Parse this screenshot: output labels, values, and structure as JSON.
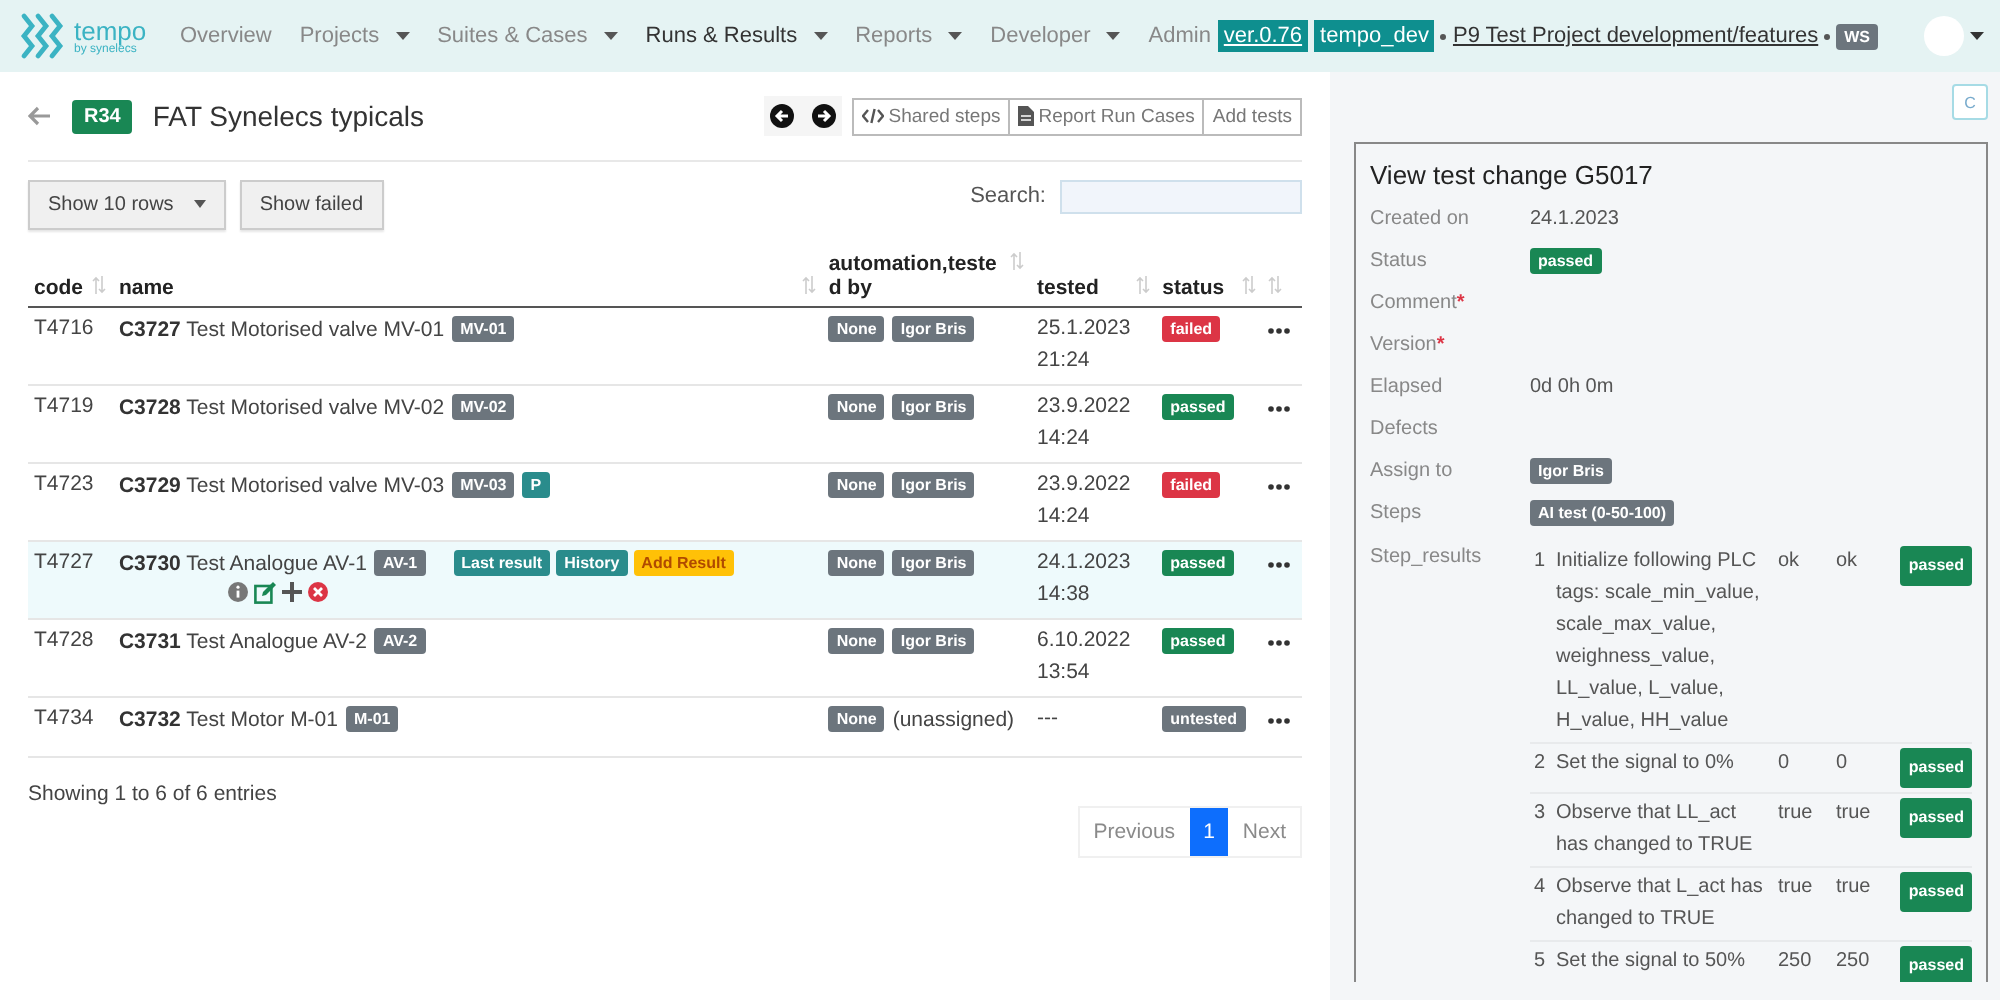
{
  "nav": {
    "logo": {
      "name": "tempo",
      "sub": "by synelecs"
    },
    "items": [
      {
        "label": "Overview",
        "dropdown": false,
        "selected": false
      },
      {
        "label": "Projects",
        "dropdown": true,
        "selected": false
      },
      {
        "label": "Suites & Cases",
        "dropdown": true,
        "selected": false
      },
      {
        "label": "Runs & Results",
        "dropdown": true,
        "selected": true
      },
      {
        "label": "Reports",
        "dropdown": true,
        "selected": false
      },
      {
        "label": "Developer",
        "dropdown": true,
        "selected": false
      },
      {
        "label": "Admin",
        "dropdown": false,
        "selected": false
      }
    ],
    "version": "ver.0.76",
    "env": "tempo_dev",
    "project": "P9 Test Project development/features",
    "user_badge": "WS"
  },
  "header": {
    "run_badge": "R34",
    "title": "FAT Synelecs typicals",
    "buttons": [
      {
        "label": "Shared steps",
        "kind": "code"
      },
      {
        "label": "Report Run Cases",
        "kind": "doc"
      },
      {
        "label": "Add tests",
        "kind": "plain"
      }
    ]
  },
  "controls": {
    "show_rows": "Show 10 rows",
    "show_failed": "Show failed",
    "search_label": "Search:"
  },
  "table": {
    "columns": [
      "code",
      "name",
      "automation,tested by",
      "tested",
      "status"
    ],
    "rows": [
      {
        "code": "T4716",
        "case": "C3727",
        "name": "Test Motorised valve MV-01",
        "tags": [
          {
            "label": "MV-01",
            "color": "#6c757d"
          }
        ],
        "selected": false,
        "automation": "None",
        "tester": "Igor Bris",
        "assigned": true,
        "tested": "25.1.2023 21:24",
        "status": {
          "label": "failed",
          "kind": "failed"
        }
      },
      {
        "code": "T4719",
        "case": "C3728",
        "name": "Test Motorised valve MV-02",
        "tags": [
          {
            "label": "MV-02",
            "color": "#6c757d"
          }
        ],
        "selected": false,
        "automation": "None",
        "tester": "Igor Bris",
        "assigned": true,
        "tested": "23.9.2022 14:24",
        "status": {
          "label": "passed",
          "kind": "passed"
        }
      },
      {
        "code": "T4723",
        "case": "C3729",
        "name": "Test Motorised valve MV-03",
        "tags": [
          {
            "label": "MV-03",
            "color": "#6c757d"
          },
          {
            "label": "P",
            "color": "#2a8c8c"
          }
        ],
        "selected": false,
        "automation": "None",
        "tester": "Igor Bris",
        "assigned": true,
        "tested": "23.9.2022 14:24",
        "status": {
          "label": "failed",
          "kind": "failed"
        }
      },
      {
        "code": "T4727",
        "case": "C3730",
        "name": "Test Analogue AV-1",
        "tags": [
          {
            "label": "AV-1",
            "color": "#6c757d"
          }
        ],
        "actions": [
          "Last result",
          "History",
          "Add Result"
        ],
        "selected": true,
        "automation": "None",
        "tester": "Igor Bris",
        "assigned": true,
        "tested": "24.1.2023 14:38",
        "status": {
          "label": "passed",
          "kind": "passed"
        }
      },
      {
        "code": "T4728",
        "case": "C3731",
        "name": "Test Analogue AV-2",
        "tags": [
          {
            "label": "AV-2",
            "color": "#6c757d"
          }
        ],
        "selected": false,
        "automation": "None",
        "tester": "Igor Bris",
        "assigned": true,
        "tested": "6.10.2022 13:54",
        "status": {
          "label": "passed",
          "kind": "passed"
        }
      },
      {
        "code": "T4734",
        "case": "C3732",
        "name": "Test Motor M-01",
        "tags": [
          {
            "label": "M-01",
            "color": "#6c757d"
          }
        ],
        "selected": false,
        "automation": "None",
        "tester": "(unassigned)",
        "assigned": false,
        "tested": "---",
        "status": {
          "label": "untested",
          "kind": "untested"
        }
      }
    ]
  },
  "footer": {
    "info": "Showing 1 to 6 of 6 entries",
    "pages": [
      {
        "label": "Previous",
        "selected": false,
        "disabled": true
      },
      {
        "label": "1",
        "selected": true,
        "disabled": false
      },
      {
        "label": "Next",
        "selected": false,
        "disabled": true
      }
    ]
  },
  "panel": {
    "corner_button": "C",
    "required_mark": "*",
    "title": "View test change G5017",
    "fields": [
      {
        "label": "Created on",
        "required": false,
        "kind": "text",
        "value": "24.1.2023"
      },
      {
        "label": "Status",
        "required": false,
        "kind": "status",
        "value": "passed"
      },
      {
        "label": "Comment",
        "required": true,
        "kind": "empty"
      },
      {
        "label": "Version",
        "required": true,
        "kind": "empty"
      },
      {
        "label": "Elapsed",
        "required": false,
        "kind": "text",
        "value": "0d 0h 0m"
      },
      {
        "label": "Defects",
        "required": false,
        "kind": "empty"
      },
      {
        "label": "Assign to",
        "required": false,
        "kind": "badge",
        "value": "Igor Bris"
      },
      {
        "label": "Steps",
        "required": false,
        "kind": "badge",
        "value": "AI test (0-50-100)"
      }
    ],
    "step_results_label": "Step_results",
    "steps": [
      {
        "num": "1",
        "text": "Initialize following PLC tags: scale_min_value, scale_max_value, weighness_value, LL_value, L_value, H_value, HH_value",
        "expected": "ok",
        "actual": "ok",
        "status": "passed"
      },
      {
        "num": "2",
        "text": "Set the signal to 0%",
        "expected": "0",
        "actual": "0",
        "status": "passed"
      },
      {
        "num": "3",
        "text": "Observe that LL_act has changed to TRUE",
        "expected": "true",
        "actual": "true",
        "status": "passed"
      },
      {
        "num": "4",
        "text": "Observe that L_act has changed to TRUE",
        "expected": "true",
        "actual": "true",
        "status": "passed"
      },
      {
        "num": "5",
        "text": "Set the signal to 50%",
        "expected": "250",
        "actual": "250",
        "status": "passed"
      }
    ]
  }
}
